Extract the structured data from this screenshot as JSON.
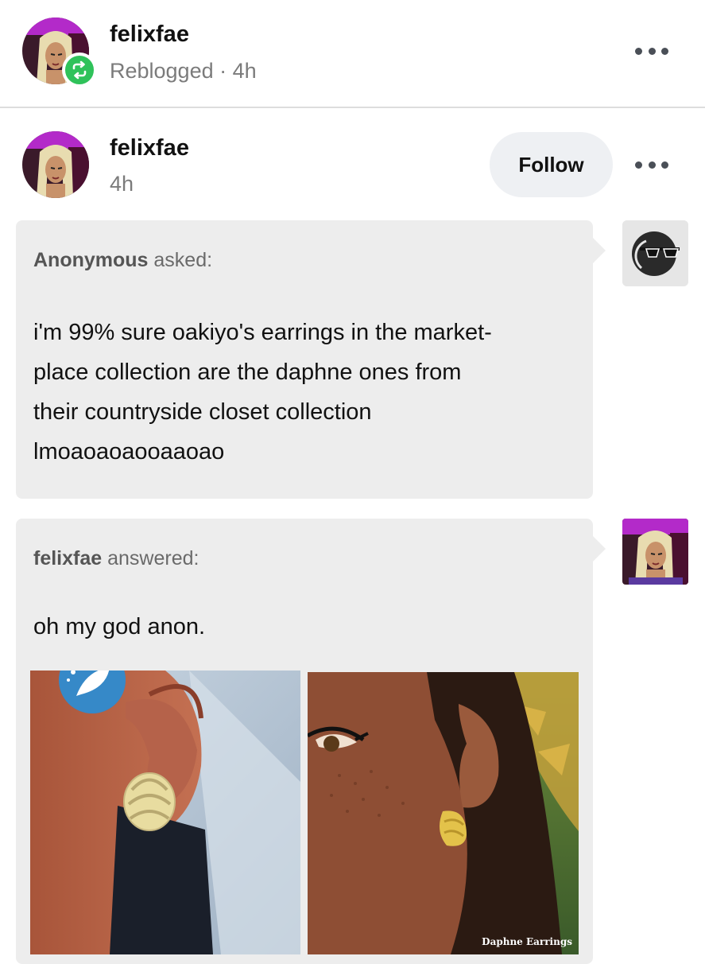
{
  "reblog_header": {
    "username": "felixfae",
    "status": "Reblogged",
    "separator": "·",
    "time": "4h"
  },
  "post_header": {
    "username": "felixfae",
    "time": "4h",
    "follow_label": "Follow"
  },
  "ask": {
    "asker": "Anonymous",
    "verb": "asked:",
    "lines": [
      "i'm 99% sure oakiyo's earrings in the market-",
      "place collection are the daphne ones from",
      "their countryside closet collection",
      "lmoaoaoaooaaoao"
    ]
  },
  "answer": {
    "author": "felixfae",
    "verb": "answered:",
    "text": "oh my god anon."
  },
  "images": {
    "right_caption": "Daphne Earrings"
  },
  "icons": {
    "reblog": "reblog-icon",
    "more": "more-options-icon",
    "anon": "anonymous-sunglasses-icon",
    "store": "leaf-badge-icon"
  },
  "colors": {
    "reblog_green": "#2fc25a",
    "bubble_bg": "#ededed",
    "follow_bg": "#eef0f3",
    "muted_text": "#7b7b7b"
  }
}
